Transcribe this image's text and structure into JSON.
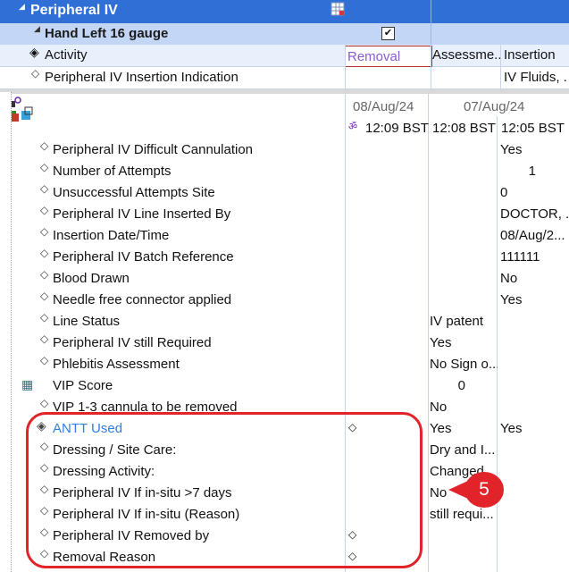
{
  "header": {
    "section_title": "Peripheral IV",
    "device_title": "Hand Left 16 gauge"
  },
  "activity_row": {
    "label": "Activity",
    "value_selected": "Removal",
    "col2": "Assessme...",
    "col3": "Insertion"
  },
  "indication_row": {
    "label": "Peripheral IV Insertion Indication",
    "col3": "IV Fluids, ."
  },
  "columns": {
    "date1": "08/Aug/24",
    "date2": "07/Aug/24",
    "time1": "12:09 BST",
    "time2": "12:08 BST",
    "time3": "12:05 BST"
  },
  "rows": [
    {
      "label": "Peripheral IV Difficult Cannulation",
      "c1": "",
      "c2": "",
      "c3": "Yes"
    },
    {
      "label": "Number of Attempts",
      "c1": "",
      "c2": "",
      "c3": "1"
    },
    {
      "label": "Unsuccessful Attempts Site",
      "c1": "",
      "c2": "",
      "c3": "0"
    },
    {
      "label": "Peripheral IV Line Inserted By",
      "c1": "",
      "c2": "",
      "c3": "DOCTOR, ..."
    },
    {
      "label": "Insertion Date/Time",
      "c1": "",
      "c2": "",
      "c3": "08/Aug/2..."
    },
    {
      "label": "Peripheral IV Batch Reference",
      "c1": "",
      "c2": "",
      "c3": "111111"
    },
    {
      "label": "Blood Drawn",
      "c1": "",
      "c2": "",
      "c3": "No"
    },
    {
      "label": "Needle free connector applied",
      "c1": "",
      "c2": "",
      "c3": "Yes"
    },
    {
      "label": "Line Status",
      "c1": "",
      "c2": "IV patent",
      "c3": ""
    },
    {
      "label": "Peripheral IV still Required",
      "c1": "",
      "c2": "Yes",
      "c3": ""
    },
    {
      "label": "Phlebitis Assessment",
      "c1": "",
      "c2": "No Sign o...",
      "c3": ""
    },
    {
      "label": "VIP Score",
      "c1": "",
      "c2": "0",
      "c3": ""
    },
    {
      "label": "VIP 1-3 cannula to be removed",
      "c1": "",
      "c2": "No",
      "c3": ""
    },
    {
      "label": "ANTT Used",
      "c1": "◇",
      "c2": "Yes",
      "c3": "Yes"
    },
    {
      "label": "Dressing / Site Care:",
      "c1": "",
      "c2": "Dry and I...",
      "c3": ""
    },
    {
      "label": "Dressing Activity:",
      "c1": "",
      "c2": "Changed",
      "c3": ""
    },
    {
      "label": "Peripheral IV If in-situ >7 days",
      "c1": "",
      "c2": "No",
      "c3": ""
    },
    {
      "label": "Peripheral IV If in-situ (Reason)",
      "c1": "",
      "c2": "still requi...",
      "c3": ""
    },
    {
      "label": "Peripheral IV Removed by",
      "c1": "◇",
      "c2": "",
      "c3": ""
    },
    {
      "label": "Removal Reason",
      "c1": "◇",
      "c2": "",
      "c3": ""
    }
  ],
  "callout": {
    "number": "5"
  },
  "colors": {
    "header_blue": "#2f6fd6",
    "highlight_red": "#e0242a",
    "link_blue": "#2f7fe0"
  }
}
